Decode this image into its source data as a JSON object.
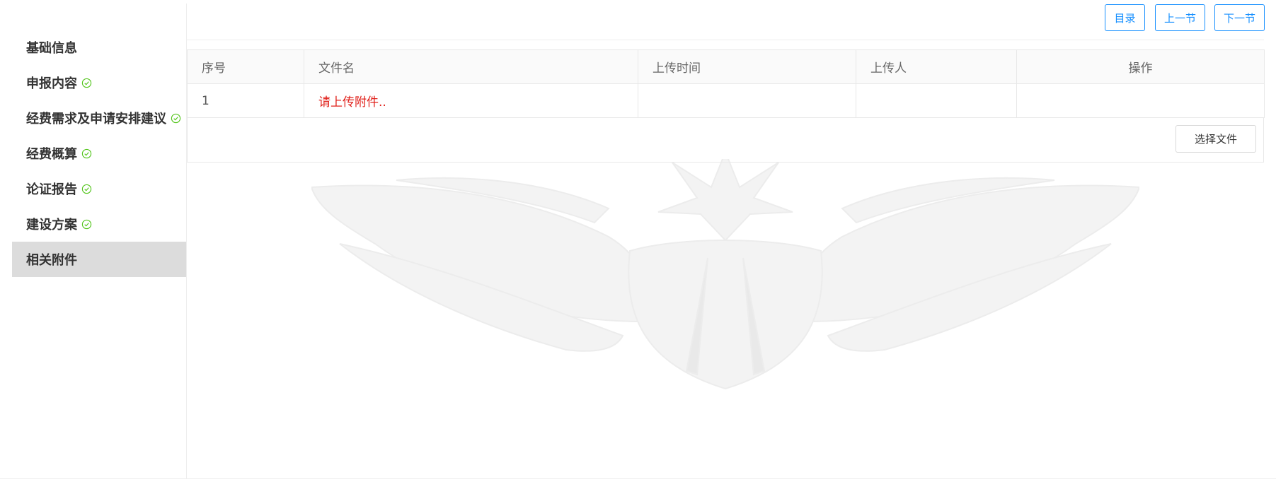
{
  "nav_buttons": {
    "catalog": "目录",
    "prev": "上一节",
    "next": "下一节"
  },
  "sidebar": {
    "items": [
      {
        "label": "基础信息",
        "completed": false,
        "active": false
      },
      {
        "label": "申报内容",
        "completed": true,
        "active": false
      },
      {
        "label": "经费需求及申请安排建议",
        "completed": true,
        "active": false
      },
      {
        "label": "经费概算",
        "completed": true,
        "active": false
      },
      {
        "label": "论证报告",
        "completed": true,
        "active": false
      },
      {
        "label": "建设方案",
        "completed": true,
        "active": false
      },
      {
        "label": "相关附件",
        "completed": false,
        "active": true
      }
    ]
  },
  "table": {
    "headers": [
      "序号",
      "文件名",
      "上传时间",
      "上传人",
      "操作"
    ],
    "rows": [
      {
        "index": "1",
        "filename": "请上传附件..",
        "upload_time": "",
        "uploader": "",
        "action": ""
      }
    ],
    "select_file_label": "选择文件"
  },
  "colors": {
    "accent": "#1890ff",
    "success": "#52c41a",
    "warning_text": "#e0201a",
    "active_bg": "#dcdcdc"
  },
  "icons": {
    "completed": "check-circle-icon",
    "watermark": "winged-star-emblem"
  }
}
